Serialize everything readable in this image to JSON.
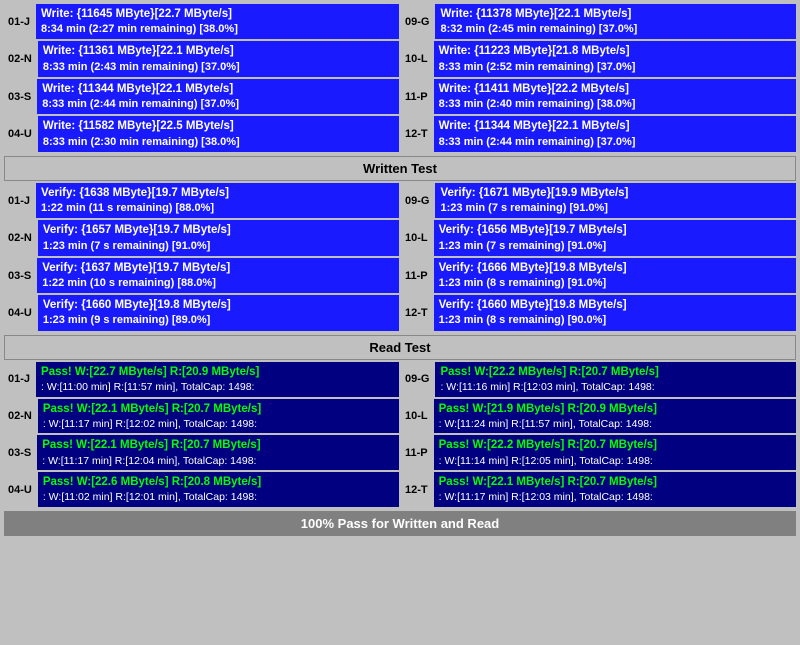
{
  "sections": {
    "write": {
      "header": "Written Test",
      "cells": [
        {
          "id": "01-J",
          "line1": "Write: {11645 MByte}[22.7 MByte/s]",
          "line2": "8:34 min (2:27 min remaining)  [38.0%]"
        },
        {
          "id": "09-G",
          "line1": "Write: {11378 MByte}[22.1 MByte/s]",
          "line2": "8:32 min (2:45 min remaining)  [37.0%]"
        },
        {
          "id": "02-N",
          "line1": "Write: {11361 MByte}[22.1 MByte/s]",
          "line2": "8:33 min (2:43 min remaining)  [37.0%]"
        },
        {
          "id": "10-L",
          "line1": "Write: {11223 MByte}[21.8 MByte/s]",
          "line2": "8:33 min (2:52 min remaining)  [37.0%]"
        },
        {
          "id": "03-S",
          "line1": "Write: {11344 MByte}[22.1 MByte/s]",
          "line2": "8:33 min (2:44 min remaining)  [37.0%]"
        },
        {
          "id": "11-P",
          "line1": "Write: {11411 MByte}[22.2 MByte/s]",
          "line2": "8:33 min (2:40 min remaining)  [38.0%]"
        },
        {
          "id": "04-U",
          "line1": "Write: {11582 MByte}[22.5 MByte/s]",
          "line2": "8:33 min (2:30 min remaining)  [38.0%]"
        },
        {
          "id": "12-T",
          "line1": "Write: {11344 MByte}[22.1 MByte/s]",
          "line2": "8:33 min (2:44 min remaining)  [37.0%]"
        }
      ]
    },
    "verify": {
      "header": "Written Test",
      "cells": [
        {
          "id": "01-J",
          "line1": "Verify: {1638 MByte}[19.7 MByte/s]",
          "line2": "1:22 min (11 s remaining)  [88.0%]"
        },
        {
          "id": "09-G",
          "line1": "Verify: {1671 MByte}[19.9 MByte/s]",
          "line2": "1:23 min (7 s remaining)  [91.0%]"
        },
        {
          "id": "02-N",
          "line1": "Verify: {1657 MByte}[19.7 MByte/s]",
          "line2": "1:23 min (7 s remaining)  [91.0%]"
        },
        {
          "id": "10-L",
          "line1": "Verify: {1656 MByte}[19.7 MByte/s]",
          "line2": "1:23 min (7 s remaining)  [91.0%]"
        },
        {
          "id": "03-S",
          "line1": "Verify: {1637 MByte}[19.7 MByte/s]",
          "line2": "1:22 min (10 s remaining)  [88.0%]"
        },
        {
          "id": "11-P",
          "line1": "Verify: {1666 MByte}[19.8 MByte/s]",
          "line2": "1:23 min (8 s remaining)  [91.0%]"
        },
        {
          "id": "04-U",
          "line1": "Verify: {1660 MByte}[19.8 MByte/s]",
          "line2": "1:23 min (9 s remaining)  [89.0%]"
        },
        {
          "id": "12-T",
          "line1": "Verify: {1660 MByte}[19.8 MByte/s]",
          "line2": "1:23 min (8 s remaining)  [90.0%]"
        }
      ]
    },
    "read": {
      "header": "Read Test",
      "cells": [
        {
          "id": "01-J",
          "line1": "Pass! W:[22.7 MByte/s] R:[20.9 MByte/s]",
          "line2": ": W:[11:00 min] R:[11:57 min], TotalCap: 1498:"
        },
        {
          "id": "09-G",
          "line1": "Pass! W:[22.2 MByte/s] R:[20.7 MByte/s]",
          "line2": ": W:[11:16 min] R:[12:03 min], TotalCap: 1498:"
        },
        {
          "id": "02-N",
          "line1": "Pass! W:[22.1 MByte/s] R:[20.7 MByte/s]",
          "line2": ": W:[11:17 min] R:[12:02 min], TotalCap: 1498:"
        },
        {
          "id": "10-L",
          "line1": "Pass! W:[21.9 MByte/s] R:[20.9 MByte/s]",
          "line2": ": W:[11:24 min] R:[11:57 min], TotalCap: 1498:"
        },
        {
          "id": "03-S",
          "line1": "Pass! W:[22.1 MByte/s] R:[20.7 MByte/s]",
          "line2": ": W:[11:17 min] R:[12:04 min], TotalCap: 1498:"
        },
        {
          "id": "11-P",
          "line1": "Pass! W:[22.2 MByte/s] R:[20.7 MByte/s]",
          "line2": ": W:[11:14 min] R:[12:05 min], TotalCap: 1498:"
        },
        {
          "id": "04-U",
          "line1": "Pass! W:[22.6 MByte/s] R:[20.8 MByte/s]",
          "line2": ": W:[11:02 min] R:[12:01 min], TotalCap: 1498:"
        },
        {
          "id": "12-T",
          "line1": "Pass! W:[22.1 MByte/s] R:[20.7 MByte/s]",
          "line2": ": W:[11:17 min] R:[12:03 min], TotalCap: 1498:"
        }
      ]
    }
  },
  "headers": {
    "write_label": "Written Test",
    "read_label": "Read Test",
    "footer": "100% Pass for Written and Read"
  }
}
